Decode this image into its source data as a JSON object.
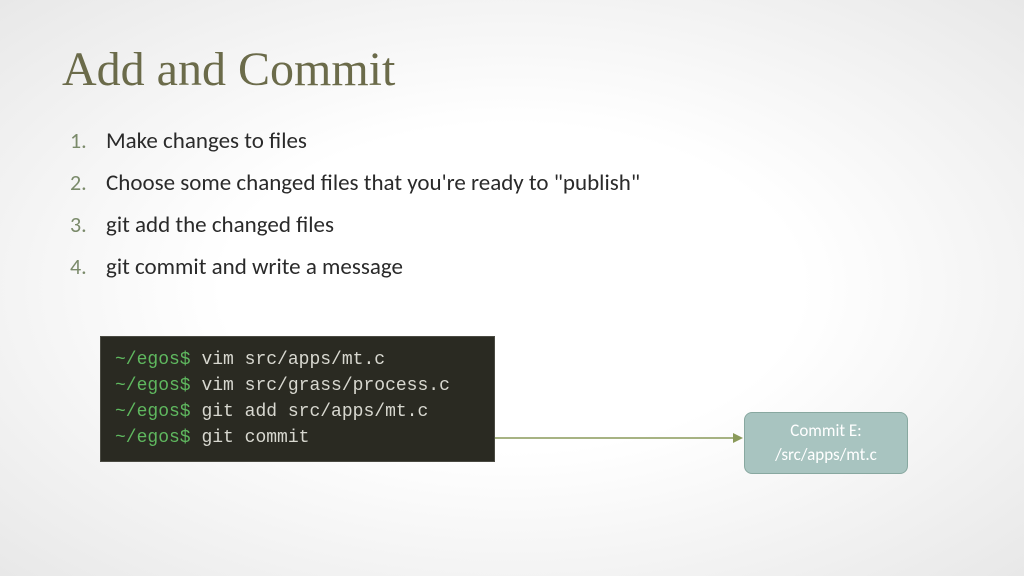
{
  "title": "Add and Commit",
  "steps": [
    {
      "num": "1.",
      "text": "Make changes to files"
    },
    {
      "num": "2.",
      "text": "Choose some changed files that you're ready to \"publish\""
    },
    {
      "num": "3.",
      "text": "git add the changed files"
    },
    {
      "num": "4.",
      "text": "git commit and write a message"
    }
  ],
  "terminal": {
    "prompt": "~/egos$",
    "lines": [
      "vim src/apps/mt.c",
      "vim src/grass/process.c",
      "git add src/apps/mt.c",
      "git commit"
    ]
  },
  "commit_box": {
    "line1": "Commit E:",
    "line2": "/src/apps/mt.c"
  }
}
